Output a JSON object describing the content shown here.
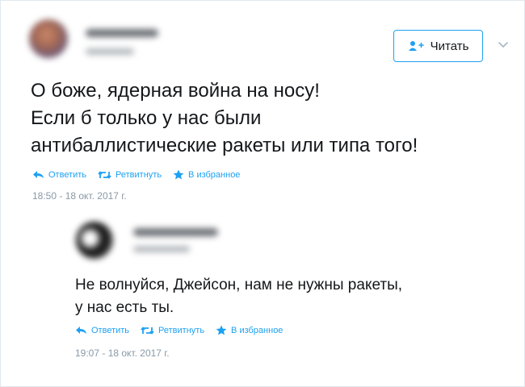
{
  "colors": {
    "accent": "#1da1f2",
    "text": "#14171a",
    "muted": "#8899a6"
  },
  "header": {
    "follow_label": "Читать",
    "follow_icon": "add-user-icon",
    "menu_icon": "chevron-down-icon"
  },
  "tweet": {
    "lines": [
      "О боже, ядерная война на носу!",
      "Если б только у нас были",
      "антибаллистические ракеты или типа того!"
    ],
    "actions": {
      "reply": "Ответить",
      "retweet": "Ретвитнуть",
      "favorite": "В избранное"
    },
    "timestamp": "18:50 - 18 окт. 2017 г."
  },
  "reply": {
    "lines": [
      "Не волнуйся, Джейсон, нам не нужны ракеты,",
      "у нас есть ты."
    ],
    "actions": {
      "reply": "Ответить",
      "retweet": "Ретвитнуть",
      "favorite": "В избранное"
    },
    "timestamp": "19:07 - 18 окт. 2017 г."
  }
}
